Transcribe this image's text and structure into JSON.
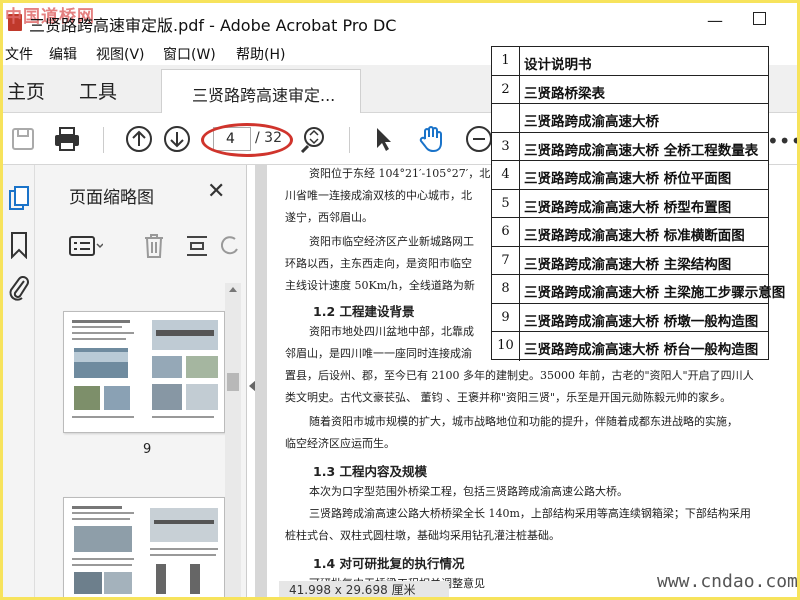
{
  "titlebar": {
    "watermark": "中国道桥网",
    "title": "三贤路跨高速审定版.pdf - Adobe Acrobat Pro DC"
  },
  "menu": [
    "文件",
    "编辑",
    "视图(V)",
    "窗口(W)",
    "帮助(H)"
  ],
  "tabs": {
    "home": "主页",
    "tools": "工具",
    "doc": "三贤路跨高速审定..."
  },
  "toolbar": {
    "page_current": "4",
    "page_total": "/ 32",
    "annotation_color": "#d0342c"
  },
  "thumbnails": {
    "title": "页面缩略图",
    "page_label": "9"
  },
  "document": {
    "lines": [
      "资阳位于东经 104°21′-105°27′，北",
      "川省唯一连接成渝双核的中心城市，北",
      "遂宁，西邻眉山。",
      "资阳市临空经济区产业新城路网工",
      "环路以西，主东西走向，是资阳市临空",
      "主线设计速度 50Km/h，全线道路为新"
    ],
    "h12": "1.2  工程建设背景",
    "p12": [
      "资阳市地处四川盆地中部，北靠成",
      "邻眉山，是四川唯一一座同时连接成渝",
      "置县，后设州、郡，至今已有 2100 多年的建制史。35000 年前，古老的\"资阳人\"开启了四川人",
      "类文明史。古代文豪苌弘、 董钧 、王褒并称\"资阳三贤\"，乐至是开国元勋陈毅元帅的家乡。",
      "随着资阳市城市规模的扩大，城市战略地位和功能的提升，伴随着成都东进战略的实施，",
      "临空经济区应运而生。"
    ],
    "h13": "1.3  工程内容及规模",
    "p13": [
      "本次为口字型范围外桥梁工程，包括三贤路跨成渝高速公路大桥。",
      "三贤路跨成渝高速公路大桥桥梁全长 140m，上部结构采用等高连续钢箱梁；下部结构采用",
      "桩柱式台、双柱式圆柱墩，基础均采用钻孔灌注桩基础。"
    ],
    "h14": "1.4  对可研批复的执行情况",
    "p14_partial": "可研批复中无桥梁工程相关调整意见"
  },
  "statusbar": "41.998 x 29.698 厘米",
  "site_watermark": "www.cndao.com",
  "toc": [
    {
      "num": "1",
      "text": "设计说明书"
    },
    {
      "num": "2",
      "text": "三贤路桥梁表"
    },
    {
      "num": "",
      "text": "三贤路跨成渝高速大桥"
    },
    {
      "num": "3",
      "text": "三贤路跨成渝高速大桥 全桥工程数量表"
    },
    {
      "num": "4",
      "text": "三贤路跨成渝高速大桥 桥位平面图"
    },
    {
      "num": "5",
      "text": "三贤路跨成渝高速大桥 桥型布置图"
    },
    {
      "num": "6",
      "text": "三贤路跨成渝高速大桥 标准横断面图"
    },
    {
      "num": "7",
      "text": "三贤路跨成渝高速大桥 主梁结构图"
    },
    {
      "num": "8",
      "text": "三贤路跨成渝高速大桥 主梁施工步骤示意图"
    },
    {
      "num": "9",
      "text": "三贤路跨成渝高速大桥 桥墩一般构造图"
    },
    {
      "num": "10",
      "text": "三贤路跨成渝高速大桥 桥台一般构造图"
    }
  ]
}
